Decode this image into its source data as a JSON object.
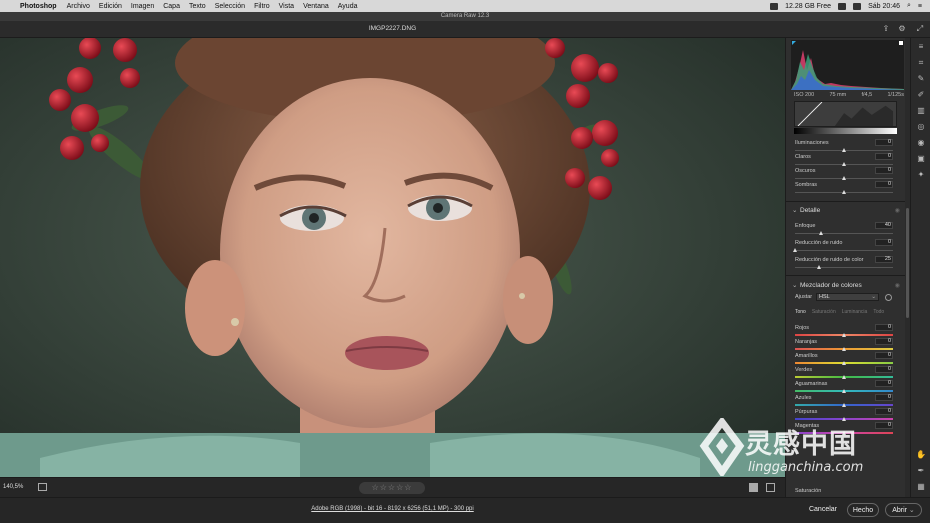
{
  "menubar": {
    "apple": "",
    "app": "Photoshop",
    "items": [
      "Archivo",
      "Edición",
      "Imagen",
      "Capa",
      "Texto",
      "Selección",
      "Filtro",
      "Vista",
      "Ventana",
      "Ayuda"
    ],
    "status": "12.28 GB Free",
    "clock": "Sáb 20:46"
  },
  "window": {
    "title": "Camera Raw 12.3"
  },
  "file": {
    "name": "IMGP2227.DNG"
  },
  "exif": {
    "iso": "ISO 200",
    "focal": "75 mm",
    "aperture": "f/4,5",
    "shutter": "1/125s"
  },
  "tone_curve": {
    "sliders": [
      {
        "label": "Iluminaciones",
        "value": "0",
        "pos": 0.5
      },
      {
        "label": "Claros",
        "value": "0",
        "pos": 0.5
      },
      {
        "label": "Oscuros",
        "value": "0",
        "pos": 0.5
      },
      {
        "label": "Sombras",
        "value": "0",
        "pos": 0.5
      }
    ]
  },
  "detalle": {
    "title": "Detalle",
    "sliders": [
      {
        "label": "Enfoque",
        "value": "40",
        "pos": 0.27
      },
      {
        "label": "Reducción de ruido",
        "value": "0",
        "pos": 0.0
      },
      {
        "label": "Reducción de ruido de color",
        "value": "25",
        "pos": 0.25
      }
    ]
  },
  "mezclador": {
    "title": "Mezclador de colores",
    "ajustar_label": "Ajustar",
    "ajustar_value": "HSL",
    "subtabs": [
      "Tono",
      "Saturación",
      "Luminancia",
      "Todo"
    ],
    "sliders": [
      {
        "label": "Rojos",
        "value": "0",
        "pos": 0.5,
        "grad": "linear-gradient(to right,#d44,#e86,#d44)"
      },
      {
        "label": "Naranjas",
        "value": "0",
        "pos": 0.5,
        "grad": "linear-gradient(to right,#d55,#e93,#dc4)"
      },
      {
        "label": "Amarillos",
        "value": "0",
        "pos": 0.5,
        "grad": "linear-gradient(to right,#e83,#dd3,#8c4)"
      },
      {
        "label": "Verdes",
        "value": "0",
        "pos": 0.5,
        "grad": "linear-gradient(to right,#bc3,#4b4,#3b9)"
      },
      {
        "label": "Aguamarinas",
        "value": "0",
        "pos": 0.5,
        "grad": "linear-gradient(to right,#4b6,#3bb,#38c)"
      },
      {
        "label": "Azules",
        "value": "0",
        "pos": 0.5,
        "grad": "linear-gradient(to right,#3aa,#36c,#64c)"
      },
      {
        "label": "Púrpuras",
        "value": "0",
        "pos": 0.5,
        "grad": "linear-gradient(to right,#44c,#84c,#c4a)"
      },
      {
        "label": "Magentas",
        "value": "0",
        "pos": 0.5,
        "grad": "linear-gradient(to right,#84c,#c4a,#d45)"
      }
    ],
    "saturacion_label": "Saturación"
  },
  "photobar": {
    "zoom": "140,5%",
    "stars": "☆☆☆☆☆"
  },
  "footer": {
    "info": "Adobe RGB (1998) - bit 16 - 8192 x 6256 (51,1 MP) - 300 ppi",
    "cancel": "Cancelar",
    "done": "Hecho",
    "open": "Abrir"
  },
  "watermark": {
    "title": "灵感中国",
    "sub": "lingganchina.com"
  }
}
